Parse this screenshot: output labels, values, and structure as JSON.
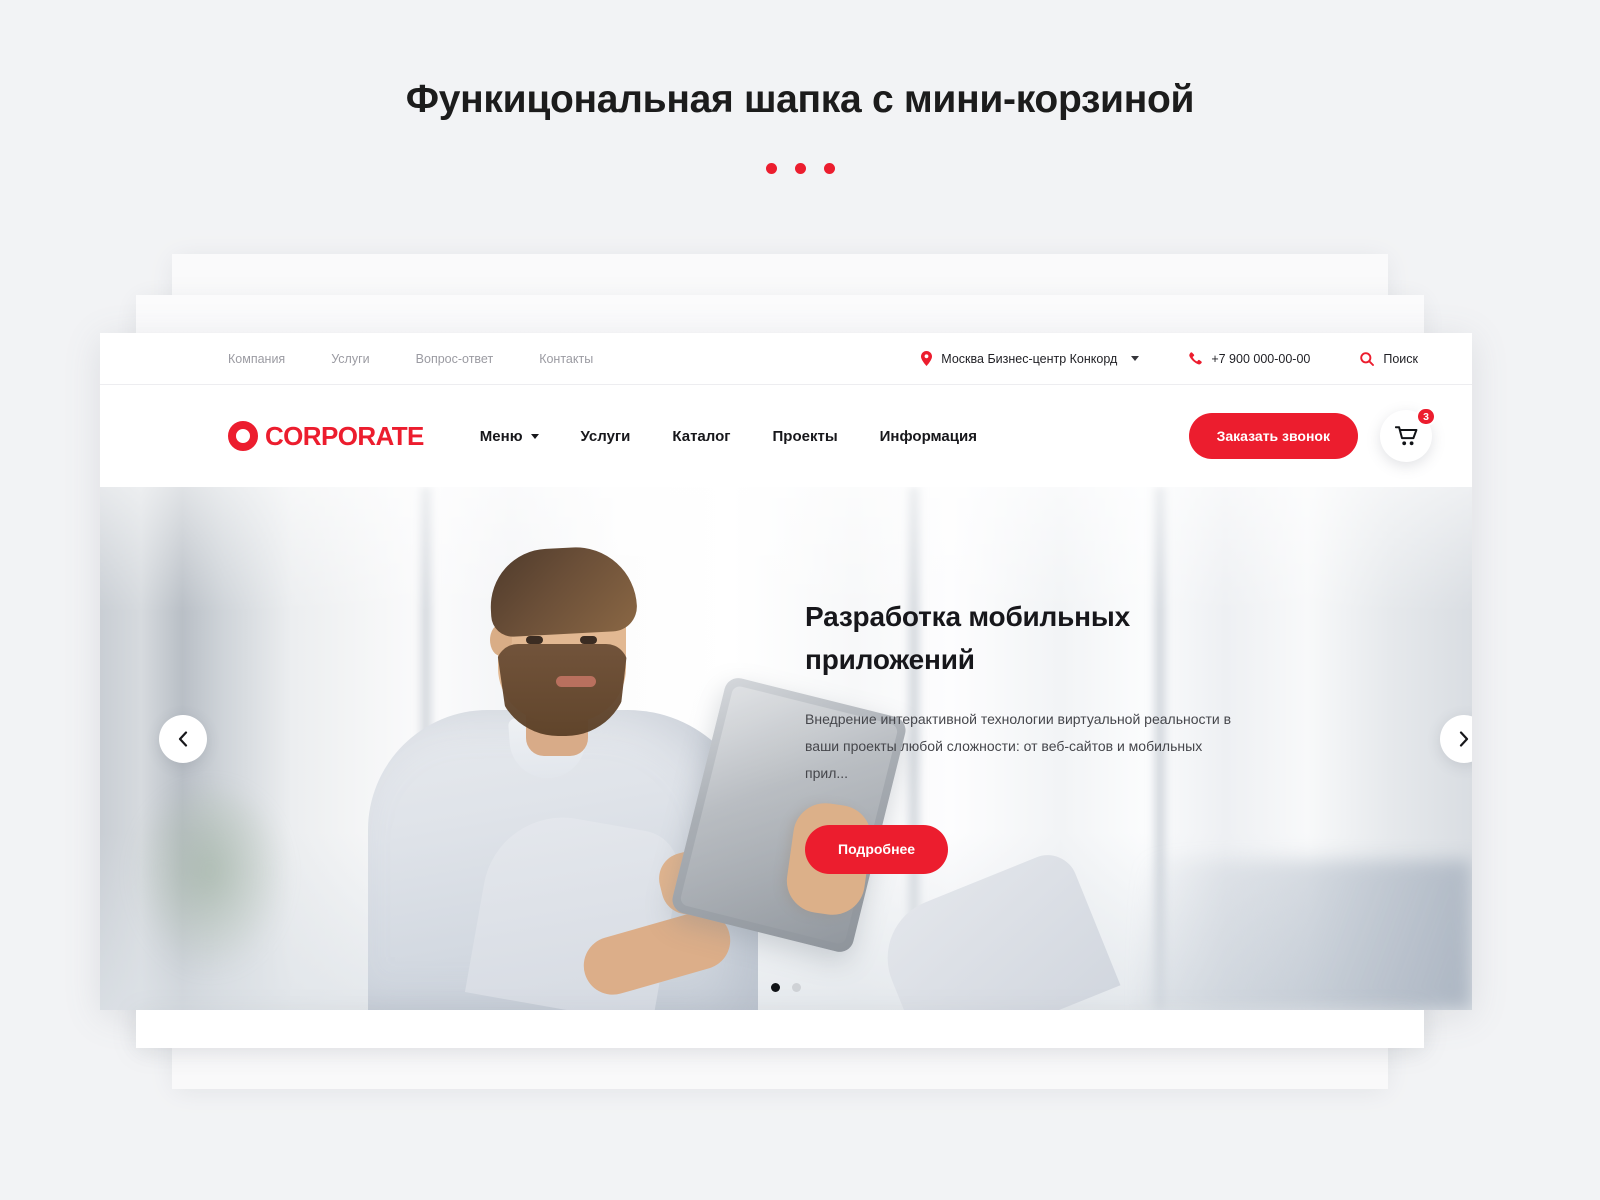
{
  "page": {
    "heading": "Функицональная шапка с мини-корзиной",
    "accent_color": "#ec1d2e",
    "background_color": "#f2f3f5",
    "decor_dots": 3
  },
  "topbar": {
    "nav": [
      {
        "label": "Компания"
      },
      {
        "label": "Услуги"
      },
      {
        "label": "Вопрос-ответ"
      },
      {
        "label": "Контакты"
      }
    ],
    "location": {
      "icon": "map-pin-icon",
      "value": "Москва Бизнес-центр Конкорд",
      "has_dropdown": true
    },
    "phone": {
      "icon": "phone-icon",
      "value": "+7 900 000-00-00"
    },
    "search": {
      "icon": "search-icon",
      "label": "Поиск"
    }
  },
  "header": {
    "logo": {
      "mark": "circle-ring-logo",
      "text": "CORPORATE"
    },
    "nav": [
      {
        "label": "Меню",
        "has_dropdown": true
      },
      {
        "label": "Услуги",
        "has_dropdown": false
      },
      {
        "label": "Каталог",
        "has_dropdown": false
      },
      {
        "label": "Проекты",
        "has_dropdown": false
      },
      {
        "label": "Информация",
        "has_dropdown": false
      }
    ],
    "call_button": "Заказать звонок",
    "cart": {
      "icon": "shopping-cart-icon",
      "badge_count": "3"
    }
  },
  "hero": {
    "title": "Разработка мобильных приложений",
    "description": "Внедрение интерактивной технологии виртуальной реальности в ваши проекты любой сложности: от веб-сайтов и мобильных прил...",
    "cta": "Подробнее",
    "prev_icon": "chevron-left-icon",
    "next_icon": "chevron-right-icon",
    "slides": 2,
    "active_slide": 1,
    "image_alt": "Мужчина с планшетом в светлом офисе"
  }
}
